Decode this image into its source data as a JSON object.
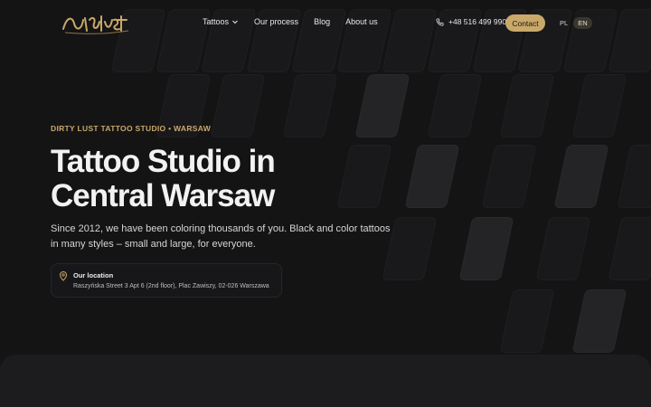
{
  "header": {
    "logo_alt": "Dirty Lust",
    "nav": [
      {
        "label": "Tattoos",
        "has_dropdown": true
      },
      {
        "label": "Our process"
      },
      {
        "label": "Blog"
      },
      {
        "label": "About us"
      }
    ],
    "phone": "+48 516 499 990",
    "contact_label": "Contact",
    "languages": [
      {
        "code": "PL",
        "active": false
      },
      {
        "code": "EN",
        "active": true
      }
    ]
  },
  "hero": {
    "eyebrow": "DIRTY LUST TATTOO STUDIO • WARSAW",
    "title": "Tattoo Studio in Central Warsaw",
    "subtitle": "Since 2012, we have been coloring thousands of you. Black and color tattoos in many styles – small and large, for everyone.",
    "location": {
      "label": "Our location",
      "address": "Raszyńska Street 3 Apt 6 (2nd floor), Plac Zawiszy, 02-026 Warszawa"
    }
  },
  "colors": {
    "background": "#141415",
    "accent": "#c9a86a"
  },
  "icons": {
    "phone": "phone-icon",
    "location": "map-pin-icon",
    "dropdown": "chevron-down-icon"
  }
}
